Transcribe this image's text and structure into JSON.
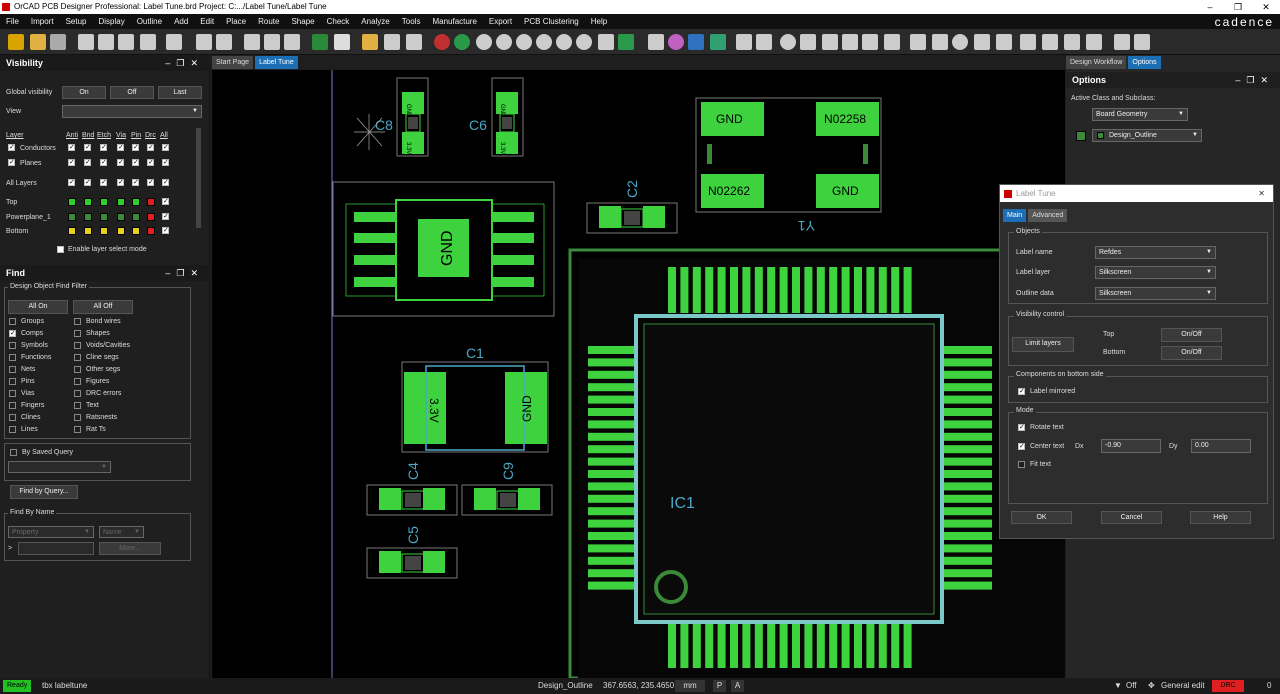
{
  "app": {
    "title": "OrCAD PCB Designer Professional: Label Tune.brd  Project: C:.../Label Tune/Label Tune",
    "brand": "cadence",
    "window_controls": [
      "–",
      "❐",
      "✕"
    ]
  },
  "menu": [
    "File",
    "Import",
    "Setup",
    "Display",
    "Outline",
    "Add",
    "Edit",
    "Place",
    "Route",
    "Shape",
    "Check",
    "Analyze",
    "Tools",
    "Manufacture",
    "Export",
    "PCB Clustering",
    "Help"
  ],
  "visibility": {
    "title": "Visibility",
    "global_label": "Global visibility",
    "btn_on": "On",
    "btn_off": "Off",
    "btn_last": "Last",
    "view_label": "View",
    "col_layer": "Layer",
    "cols": [
      "Anti",
      "Bnd",
      "Etch",
      "Via",
      "Pin",
      "Drc",
      "All"
    ],
    "rows": [
      "Conductors",
      "Planes",
      "All Layers",
      "Top",
      "Powerplane_1",
      "Bottom"
    ],
    "enable_layer_select": "Enable layer select mode"
  },
  "find": {
    "title": "Find",
    "filter_title": "Design Object Find Filter",
    "all_on": "All On",
    "all_off": "All Off",
    "left_items": [
      "Groups",
      "Comps",
      "Symbols",
      "Functions",
      "Nets",
      "Pins",
      "Vias",
      "Fingers",
      "Clines",
      "Lines"
    ],
    "right_items": [
      "Bond wires",
      "Shapes",
      "Voids/Cavities",
      "Cline segs",
      "Other segs",
      "Figures",
      "DRC errors",
      "Text",
      "Ratsnests",
      "Rat Ts"
    ],
    "by_saved_query": "By Saved Query",
    "find_by_query": "Find by Query...",
    "find_by_name": "Find By Name",
    "property": "Property",
    "name": "Name",
    "more": "More...",
    "arrow": ">"
  },
  "doc_tabs": [
    "Start Page",
    "Label Tune"
  ],
  "canvas": {
    "refdes": [
      "C8",
      "C6",
      "C2",
      "C1",
      "C4",
      "C9",
      "C5",
      "IC1",
      "Y1"
    ],
    "pad_labels": {
      "gnd": "GND",
      "n1": "N02258",
      "n2": "N02262",
      "v33": "3.3V"
    }
  },
  "right_panel": {
    "tabs": [
      "Design Workflow",
      "Options"
    ],
    "title": "Options",
    "active_class_label": "Active Class and Subclass:",
    "class": "Board Geometry",
    "subclass": "Design_Outline"
  },
  "label_tune": {
    "title": "Label Tune",
    "tabs": [
      "Main",
      "Advanced"
    ],
    "objects": "Objects",
    "label_name": "Label name",
    "label_name_val": "Refdes",
    "label_layer": "Label layer",
    "label_layer_val": "Silkscreen",
    "outline_data": "Outline data",
    "outline_data_val": "Silkscreen",
    "visibility_control": "Visibility control",
    "limit_layers": "Limit layers",
    "top": "Top",
    "bottom": "Bottom",
    "onoff": "On/Off",
    "bottom_side": "Components on bottom side",
    "label_mirrored": "Label mirrored",
    "mode": "Mode",
    "rotate_text": "Rotate text",
    "center_text": "Center text",
    "dx": "Dx",
    "dx_val": "-0.90",
    "dy": "Dy",
    "dy_val": "0.00",
    "fit_text": "Fit text",
    "ok": "OK",
    "cancel": "Cancel",
    "help": "Help"
  },
  "status": {
    "ready": "Ready",
    "command": "tbx labeltune",
    "subclass": "Design_Outline",
    "coords": "367.6563, 235.4650",
    "units": "mm",
    "p": "P",
    "a": "A",
    "off": "Off",
    "mode": "General edit",
    "drc": "DRC",
    "drc_count": "0"
  },
  "colors": {
    "pad": "#3fd23f",
    "silk": "#4aa8c8",
    "outline": "#7a7ad0",
    "accent": "#1d6fb5",
    "ready": "#22c022"
  }
}
